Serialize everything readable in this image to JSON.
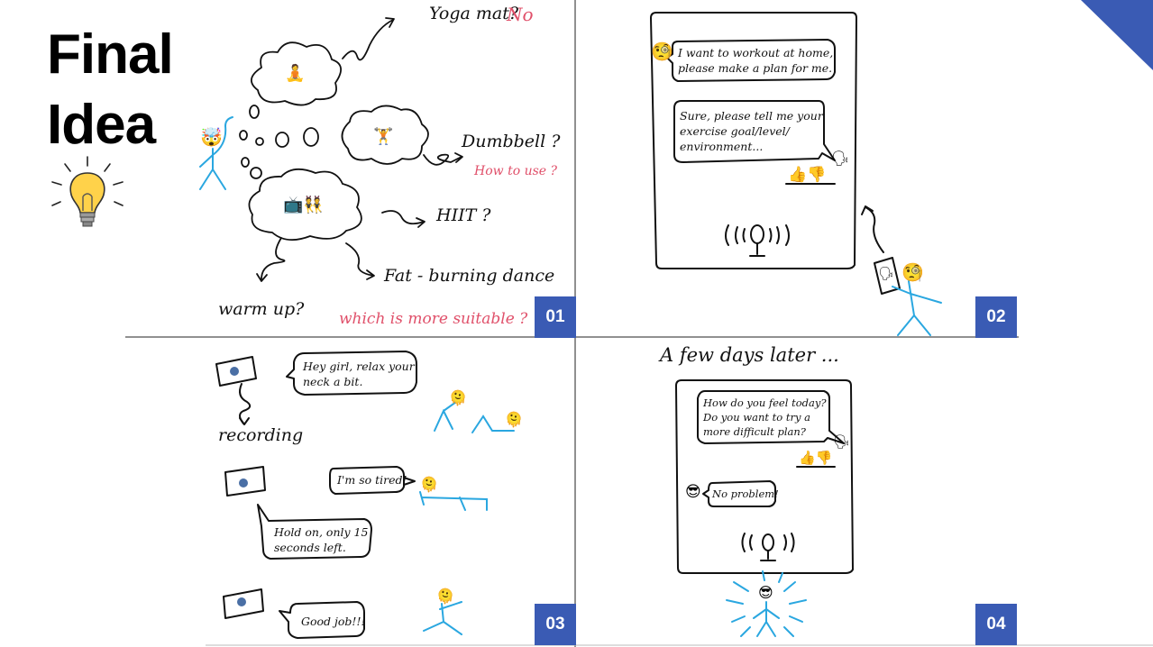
{
  "title": {
    "line1": "Final",
    "line2": "Idea"
  },
  "panels": {
    "p1": {
      "number": "01",
      "thought_icons": {
        "yoga": "🧘",
        "dumbbell": "🏋",
        "tv_dance": "📺👯"
      },
      "yoga_label": "Yoga mat?",
      "yoga_answer": "No",
      "dumbbell_label": "Dumbbell ?",
      "dumbbell_question": "How to use ?",
      "hiit_label": "HIIT ?",
      "dance_label": "Fat - burning dance",
      "warmup_label": "warm up?",
      "question": "which is more suitable ?",
      "person_emoji": "🤯"
    },
    "p2": {
      "number": "02",
      "user_msg_line1": "I want to workout at home,",
      "user_msg_line2": "please make a plan for me.",
      "ai_msg_line1": "Sure, please tell me your",
      "ai_msg_line2": "exercise goal/level/",
      "ai_msg_line3": "environment...",
      "feedback": "👍👎",
      "user_emoji": "🧐",
      "ai_emoji": "🗣"
    },
    "p3": {
      "number": "03",
      "recording_label": "recording",
      "msg1_line1": "Hey girl, relax your",
      "msg1_line2": "neck a bit.",
      "msg2": "I'm so tired!",
      "msg3_line1": "Hold on, only 15",
      "msg3_line2": "seconds left.",
      "msg4": "Good job!!!",
      "person_emoji": "🫠"
    },
    "p4": {
      "number": "04",
      "caption": "A few days later ...",
      "ai_msg_line1": "How do you feel today?",
      "ai_msg_line2": "Do you want to try a",
      "ai_msg_line3": "more difficult plan?",
      "feedback": "👍👎",
      "user_msg": "No problem!",
      "user_emoji": "😎"
    }
  },
  "colors": {
    "badge": "#3a5bb4",
    "accent_red": "#e0506a",
    "stick_figure": "#2aa7e0",
    "corner": "#3a5bb4"
  }
}
